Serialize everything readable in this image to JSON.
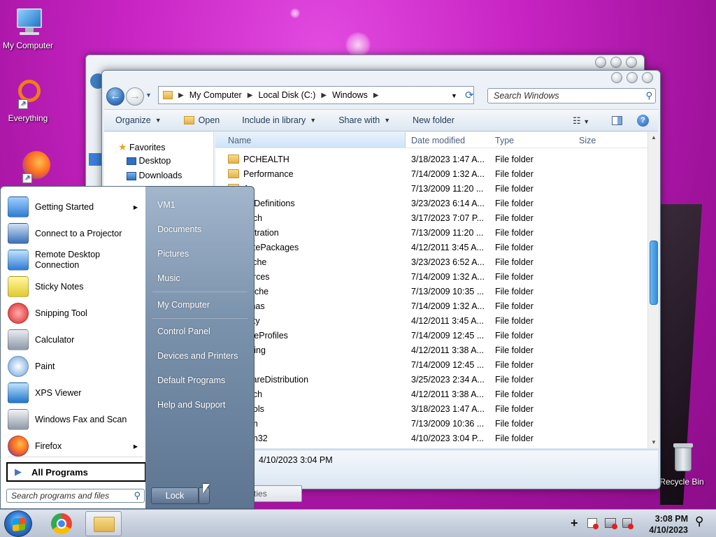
{
  "desktop": {
    "icons": [
      {
        "label": "My Computer"
      },
      {
        "label": "Everything"
      },
      {
        "label": "Recycle Bin"
      }
    ]
  },
  "explorer": {
    "address": {
      "parts": [
        "My Computer",
        "Local Disk (C:)",
        "Windows"
      ]
    },
    "search_placeholder": "Search Windows",
    "toolbar": {
      "organize": "Organize",
      "open": "Open",
      "include": "Include in library",
      "share": "Share with",
      "newfolder": "New folder"
    },
    "navpane": {
      "favorites": "Favorites",
      "desktop": "Desktop",
      "downloads": "Downloads"
    },
    "columns": {
      "name": "Name",
      "date": "Date modified",
      "type": "Type",
      "size": "Size"
    },
    "rows": [
      {
        "name": "PCHEALTH",
        "date": "3/18/2023 1:47 A...",
        "type": "File folder"
      },
      {
        "name": "Performance",
        "date": "7/14/2009 1:32 A...",
        "type": "File folder"
      },
      {
        "name": "A",
        "date": "7/13/2009 11:20 ...",
        "type": "File folder"
      },
      {
        "name": "icyDefinitions",
        "date": "3/23/2023 6:14 A...",
        "type": "File folder"
      },
      {
        "name": "fetch",
        "date": "3/17/2023 7:07 P...",
        "type": "File folder"
      },
      {
        "name": "gistration",
        "date": "7/13/2009 11:20 ...",
        "type": "File folder"
      },
      {
        "name": "notePackages",
        "date": "4/12/2011 3:45 A...",
        "type": "File folder"
      },
      {
        "name": "cache",
        "date": "3/23/2023 6:52 A...",
        "type": "File folder"
      },
      {
        "name": "ources",
        "date": "7/14/2009 1:32 A...",
        "type": "File folder"
      },
      {
        "name": "Cache",
        "date": "7/13/2009 10:35 ...",
        "type": "File folder"
      },
      {
        "name": "emas",
        "date": "7/14/2009 1:32 A...",
        "type": "File folder"
      },
      {
        "name": "urity",
        "date": "4/12/2011 3:45 A...",
        "type": "File folder"
      },
      {
        "name": "viceProfiles",
        "date": "7/14/2009 12:45 ...",
        "type": "File folder"
      },
      {
        "name": "vicing",
        "date": "4/12/2011 3:38 A...",
        "type": "File folder"
      },
      {
        "name": "up",
        "date": "7/14/2009 12:45 ...",
        "type": "File folder"
      },
      {
        "name": "twareDistribution",
        "date": "3/25/2023 2:34 A...",
        "type": "File folder"
      },
      {
        "name": "eech",
        "date": "4/12/2011 3:38 A...",
        "type": "File folder"
      },
      {
        "name": "nbols",
        "date": "3/18/2023 1:47 A...",
        "type": "File folder"
      },
      {
        "name": "tem",
        "date": "7/13/2009 10:36 ...",
        "type": "File folder"
      },
      {
        "name": "tem32",
        "date": "4/10/2023 3:04 P...",
        "type": "File folder"
      }
    ],
    "details": {
      "date": "4/10/2023 3:04 PM"
    },
    "properties_tooltip": "Properties"
  },
  "startmenu": {
    "programs": [
      {
        "label": "Getting Started",
        "arrow": "▶"
      },
      {
        "label": "Connect to a Projector",
        "arrow": ""
      },
      {
        "label": "Remote Desktop\nConnection",
        "arrow": ""
      },
      {
        "label": "Sticky Notes",
        "arrow": ""
      },
      {
        "label": "Snipping Tool",
        "arrow": ""
      },
      {
        "label": "Calculator",
        "arrow": ""
      },
      {
        "label": "Paint",
        "arrow": ""
      },
      {
        "label": "XPS Viewer",
        "arrow": ""
      },
      {
        "label": "Windows Fax and Scan",
        "arrow": ""
      },
      {
        "label": "Firefox",
        "arrow": "▶"
      }
    ],
    "all_programs": "All Programs",
    "search_placeholder": "Search programs and files",
    "right": {
      "user": "VM1",
      "documents": "Documents",
      "pictures": "Pictures",
      "music": "Music",
      "computer": "My Computer",
      "control": "Control Panel",
      "devices": "Devices and Printers",
      "defaults": "Default Programs",
      "help": "Help and Support"
    },
    "lock": "Lock"
  },
  "taskbar": {
    "time": "3:08 PM",
    "date": "4/10/2023"
  }
}
